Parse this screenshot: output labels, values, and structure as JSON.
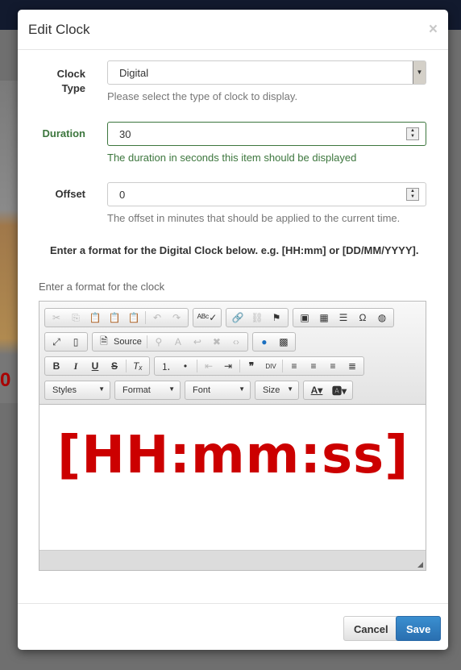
{
  "modal": {
    "title": "Edit Clock",
    "close": "×"
  },
  "fields": {
    "clock_type": {
      "label_1": "Clock",
      "label_2": "Type",
      "value": "Digital",
      "help": "Please select the type of clock to display."
    },
    "duration": {
      "label": "Duration",
      "value": "30",
      "help": "The duration in seconds this item should be displayed"
    },
    "offset": {
      "label": "Offset",
      "value": "0",
      "help": "The offset in minutes that should be applied to the current time."
    }
  },
  "note": "Enter a format for the Digital Clock below. e.g. [HH:mm] or [DD/MM/YYYY].",
  "editor": {
    "label": "Enter a format for the clock",
    "source": "Source",
    "styles": "Styles",
    "format": "Format",
    "font": "Font",
    "size": "Size",
    "content": "[HH:mm:ss]",
    "content_color": "#cc0000"
  },
  "footer": {
    "cancel": "Cancel",
    "save": "Save"
  },
  "background": {
    "partial_text": "0"
  }
}
